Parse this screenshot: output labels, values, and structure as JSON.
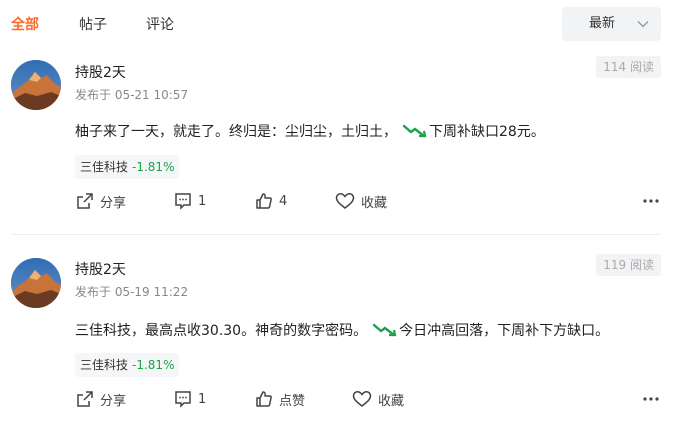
{
  "tabs": [
    {
      "label": "全部",
      "active": true
    },
    {
      "label": "帖子",
      "active": false
    },
    {
      "label": "评论",
      "active": false
    }
  ],
  "sort": {
    "selected": "最新"
  },
  "colors": {
    "accent": "#ff6a2a",
    "down_green": "#1aa34a",
    "muted": "#888888"
  },
  "posts": [
    {
      "author": "持股2天",
      "published": "发布于 05-21 10:57",
      "views": "114 阅读",
      "text_before_icon": "柚子来了一天，就走了。终归是：尘归尘，土归土，",
      "icon": "falling-trend-icon",
      "text_after_icon": "下周补缺口28元。",
      "stock": {
        "name": "三佳科技",
        "change": "-1.81%"
      },
      "actions": {
        "share": "分享",
        "comments": "1",
        "likes": "4",
        "favorite": "收藏"
      }
    },
    {
      "author": "持股2天",
      "published": "发布于 05-19 11:22",
      "views": "119 阅读",
      "text_before_icon": "三佳科技，最高点收30.30。神奇的数字密码。",
      "icon": "falling-trend-icon",
      "text_after_icon": "今日冲高回落，下周补下方缺口。",
      "stock": {
        "name": "三佳科技",
        "change": "-1.81%"
      },
      "actions": {
        "share": "分享",
        "comments": "1",
        "likes": "点赞",
        "favorite": "收藏"
      }
    }
  ]
}
